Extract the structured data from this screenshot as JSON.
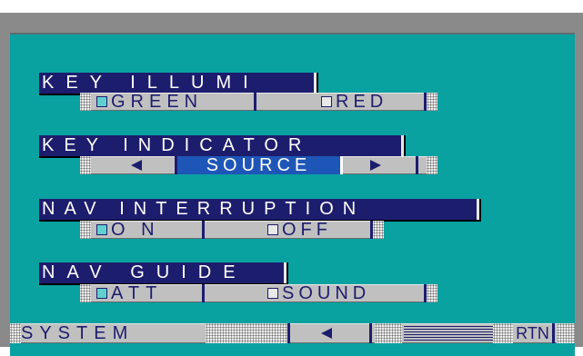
{
  "menu": {
    "key_illumi": {
      "title": "KEY  ILLUMI",
      "options": [
        "GREEN",
        "RED"
      ],
      "selected": "GREEN"
    },
    "key_indicator": {
      "title": "KEY  INDICATOR",
      "value": "SOURCE"
    },
    "nav_interruption": {
      "title": "NAV  INTERRUPTION",
      "options": [
        "O N",
        "OFF"
      ],
      "selected": "O N"
    },
    "nav_guide": {
      "title": "NAV  GUIDE",
      "options": [
        "ATT",
        "SOUND"
      ],
      "selected": "ATT"
    }
  },
  "bottom_bar": {
    "system_label": "SYSTEM",
    "return_label": "RTN"
  },
  "colors": {
    "screen": "#0aa1a1",
    "header": "#1d1d6e",
    "row": "#c0c0c0",
    "selected": "#1e56b8",
    "checkbox_on": "#5fcfd0"
  },
  "icons": {
    "prev": "triangle-left-icon",
    "next": "triangle-right-icon",
    "back": "triangle-left-icon"
  }
}
